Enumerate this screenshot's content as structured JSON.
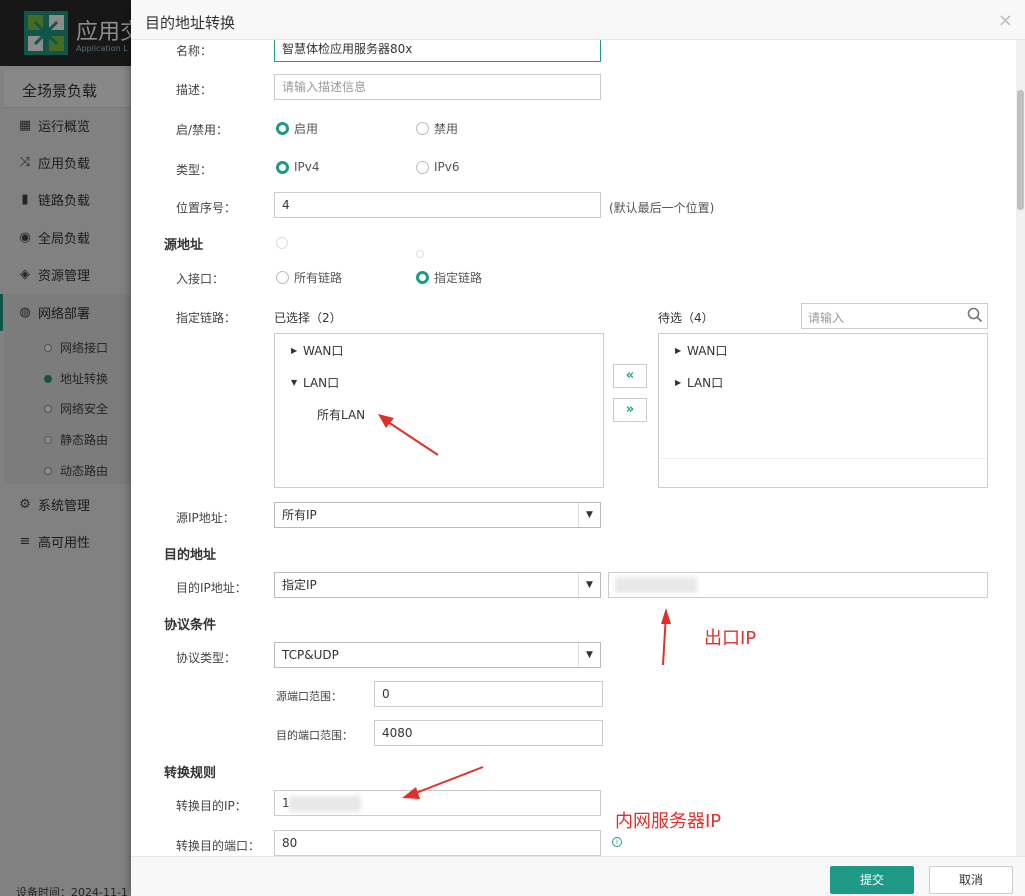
{
  "app": {
    "title": "应用交",
    "subtitle": "Application L",
    "sidebar_header": "全场景负载",
    "nav": [
      {
        "label": "运行概览",
        "icon": "dashboard-icon"
      },
      {
        "label": "应用负载",
        "icon": "shuffle-icon"
      },
      {
        "label": "链路负载",
        "icon": "link-icon"
      },
      {
        "label": "全局负载",
        "icon": "globe-icon"
      },
      {
        "label": "资源管理",
        "icon": "layers-icon"
      },
      {
        "label": "网络部署",
        "icon": "network-icon"
      },
      {
        "label": "系统管理",
        "icon": "gear-icon"
      },
      {
        "label": "高可用性",
        "icon": "list-icon"
      }
    ],
    "subnav": [
      {
        "label": "网络接口",
        "active": false
      },
      {
        "label": "地址转换",
        "active": true
      },
      {
        "label": "网络安全",
        "active": false
      },
      {
        "label": "静态路由",
        "active": false
      },
      {
        "label": "动态路由",
        "active": false
      }
    ],
    "device_time": "设备时间：2024-11-1"
  },
  "dialog": {
    "title": "目的地址转换",
    "close": "×",
    "name_label": "名称：",
    "name_value": "智慧体检应用服务器80x",
    "desc_label": "描述：",
    "desc_placeholder": "请输入描述信息",
    "enable_label": "启/禁用：",
    "enable_on": "启用",
    "enable_off": "禁用",
    "type_label": "类型：",
    "type_v4": "IPv4",
    "type_v6": "IPv6",
    "position_label": "位置序号：",
    "position_value": "4",
    "position_hint": "(默认最后一个位置)",
    "source": {
      "section": "源地址",
      "inbound_label": "入接口：",
      "inbound_all": "所有链路",
      "inbound_specific": "指定链路",
      "link_label": "指定链路：",
      "selected_title": "已选择（2）",
      "pending_title": "待选（4）",
      "search_placeholder": "请输入",
      "selected_items": [
        "WAN口",
        "LAN口",
        "所有LAN"
      ],
      "pending_items": [
        "WAN口",
        "LAN口"
      ],
      "move_left": "«",
      "move_right": "»",
      "ip_label": "源IP地址：",
      "ip_value": "所有IP"
    },
    "dest": {
      "section": "目的地址",
      "ip_label": "目的IP地址：",
      "ip_value": "指定IP"
    },
    "protocol": {
      "section": "协议条件",
      "type_label": "协议类型：",
      "type_value": "TCP&UDP",
      "src_port_label": "源端口范围：",
      "src_port_value": "0",
      "dst_port_label": "目的端口范围：",
      "dst_port_value": "4080"
    },
    "rule": {
      "section": "转换规则",
      "ip_label": "转换目的IP：",
      "ip_value": "1",
      "port_label": "转换目的端口：",
      "port_value": "80"
    },
    "submit": "提交",
    "cancel": "取消"
  },
  "annotations": {
    "exit_ip": "出口IP",
    "internal_ip": "内网服务器IP",
    "color": "#e0302a"
  }
}
